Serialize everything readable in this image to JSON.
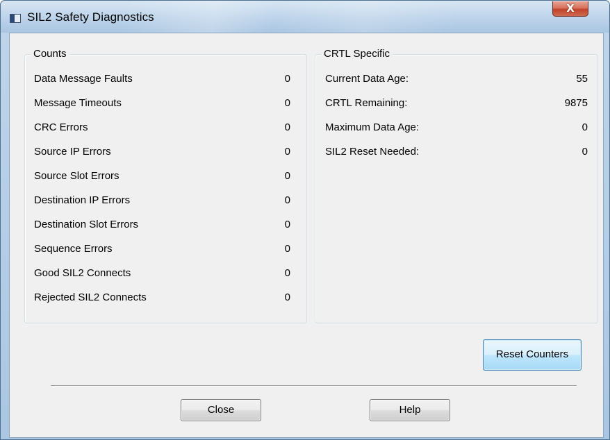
{
  "window": {
    "title": "SIL2 Safety Diagnostics",
    "close_glyph": "X"
  },
  "counts": {
    "title": "Counts",
    "rows": [
      {
        "label": "Data Message Faults",
        "value": "0"
      },
      {
        "label": "Message Timeouts",
        "value": "0"
      },
      {
        "label": "CRC Errors",
        "value": "0"
      },
      {
        "label": "Source IP Errors",
        "value": "0"
      },
      {
        "label": "Source Slot Errors",
        "value": "0"
      },
      {
        "label": "Destination IP Errors",
        "value": "0"
      },
      {
        "label": "Destination Slot Errors",
        "value": "0"
      },
      {
        "label": "Sequence Errors",
        "value": "0"
      },
      {
        "label": "Good SIL2 Connects",
        "value": "0"
      },
      {
        "label": "Rejected SIL2 Connects",
        "value": "0"
      }
    ]
  },
  "crtl": {
    "title": "CRTL Specific",
    "rows": [
      {
        "label": "Current Data Age:",
        "value": "55"
      },
      {
        "label": "CRTL Remaining:",
        "value": "9875"
      },
      {
        "label": "Maximum Data Age:",
        "value": "0"
      },
      {
        "label": "SIL2 Reset Needed:",
        "value": "0"
      }
    ]
  },
  "buttons": {
    "reset": "Reset Counters",
    "close": "Close",
    "help": "Help"
  },
  "icons": {
    "title_icon": "window-app-icon",
    "close_icon": "close-icon"
  }
}
